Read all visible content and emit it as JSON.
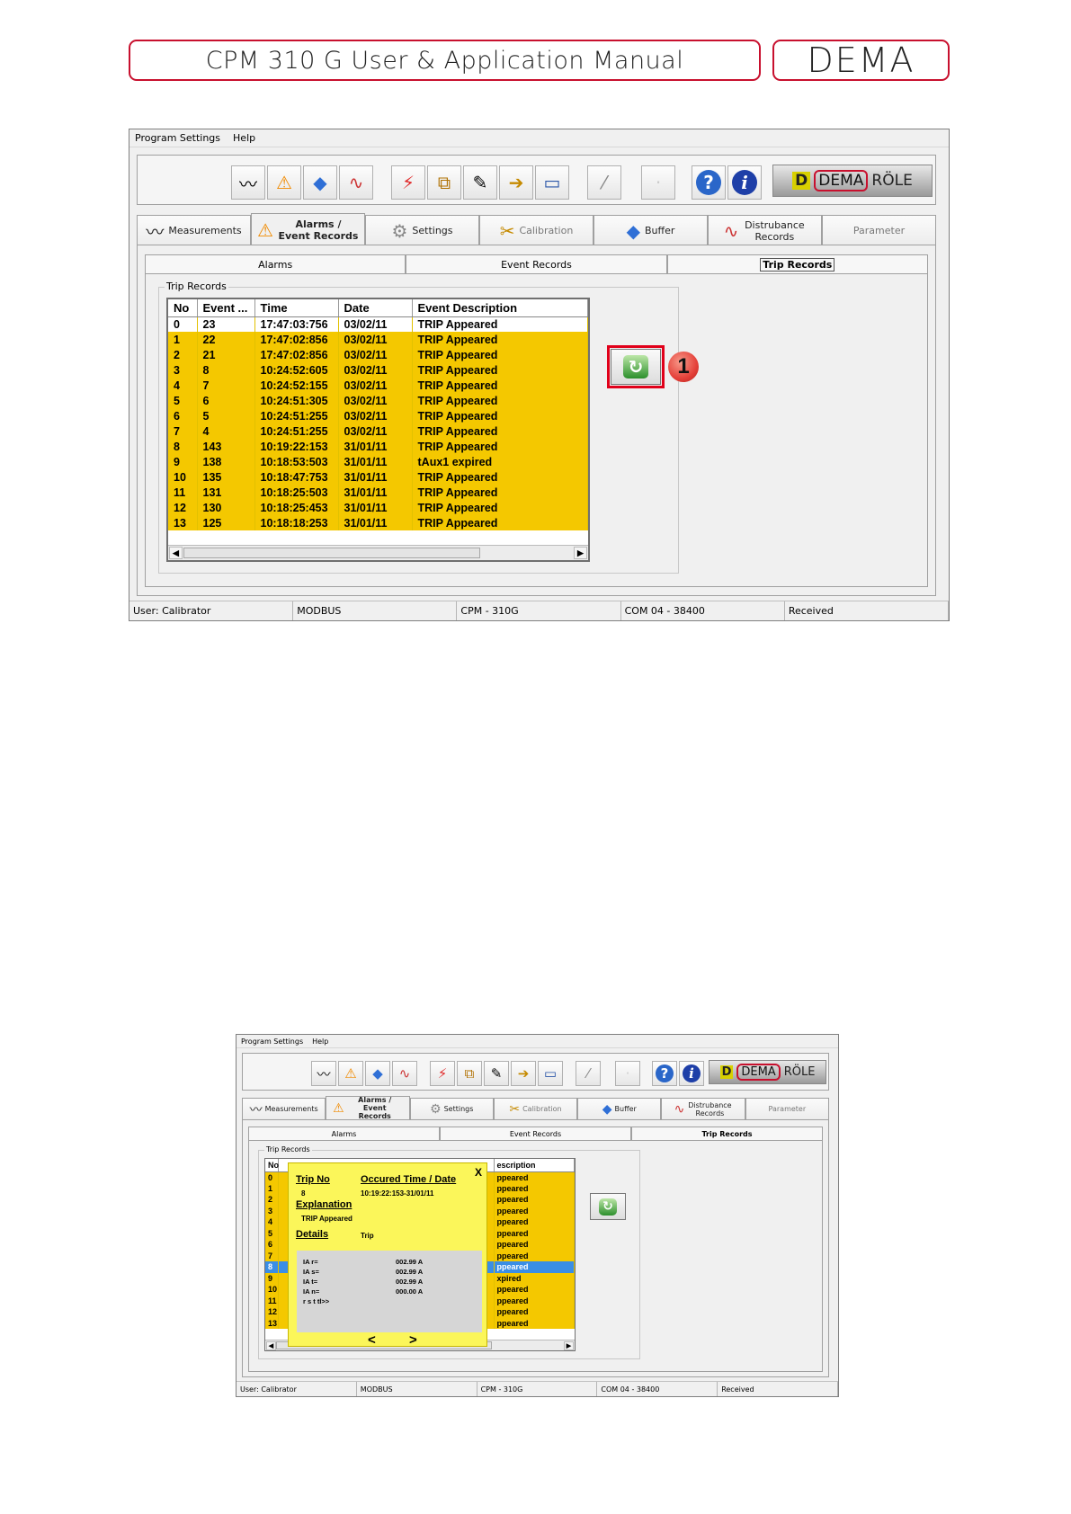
{
  "header": {
    "title": "CPM 310 G User & Application Manual",
    "logo": "DEMA"
  },
  "menu": [
    "Program Settings",
    "Help"
  ],
  "toolbar_icons": [
    "waveform-icon",
    "warning-icon",
    "gem-icon",
    "chart-icon",
    "breaker-icon",
    "transformer-icon",
    "tools-icon",
    "export-icon",
    "device-icon",
    "wand-icon",
    "blank-icon",
    "help-icon",
    "info-icon"
  ],
  "toolbar_logo": {
    "mark": "D",
    "brand": "DEMA",
    "suffix": "RÖLE"
  },
  "tabs": [
    {
      "label": "Measurements",
      "icon": "waveform-icon"
    },
    {
      "label": "Alarms / Event Records",
      "icon": "warning-icon"
    },
    {
      "label": "Settings",
      "icon": "gears-icon"
    },
    {
      "label": "Calibration",
      "icon": "tools-icon"
    },
    {
      "label": "Buffer",
      "icon": "gem-icon"
    },
    {
      "label": "Distrubance Records",
      "icon": "chart-icon"
    },
    {
      "label": "Parameter",
      "icon": ""
    }
  ],
  "subtabs": [
    "Alarms",
    "Event Records",
    "Trip Records"
  ],
  "group_title": "Trip Records",
  "columns": [
    "No",
    "Event ...",
    "Time",
    "Date",
    "Event Description"
  ],
  "rows": [
    [
      "0",
      "23",
      "17:47:03:756",
      "03/02/11",
      "TRIP Appeared"
    ],
    [
      "1",
      "22",
      "17:47:02:856",
      "03/02/11",
      "TRIP Appeared"
    ],
    [
      "2",
      "21",
      "17:47:02:856",
      "03/02/11",
      "TRIP Appeared"
    ],
    [
      "3",
      "8",
      "10:24:52:605",
      "03/02/11",
      "TRIP Appeared"
    ],
    [
      "4",
      "7",
      "10:24:52:155",
      "03/02/11",
      "TRIP Appeared"
    ],
    [
      "5",
      "6",
      "10:24:51:305",
      "03/02/11",
      "TRIP Appeared"
    ],
    [
      "6",
      "5",
      "10:24:51:255",
      "03/02/11",
      "TRIP Appeared"
    ],
    [
      "7",
      "4",
      "10:24:51:255",
      "03/02/11",
      "TRIP Appeared"
    ],
    [
      "8",
      "143",
      "10:19:22:153",
      "31/01/11",
      "TRIP Appeared"
    ],
    [
      "9",
      "138",
      "10:18:53:503",
      "31/01/11",
      "tAux1 expired"
    ],
    [
      "10",
      "135",
      "10:18:47:753",
      "31/01/11",
      "TRIP Appeared"
    ],
    [
      "11",
      "131",
      "10:18:25:503",
      "31/01/11",
      "TRIP Appeared"
    ],
    [
      "12",
      "130",
      "10:18:25:453",
      "31/01/11",
      "TRIP Appeared"
    ],
    [
      "13",
      "125",
      "10:18:18:253",
      "31/01/11",
      "TRIP Appeared"
    ]
  ],
  "callout": "1",
  "status": [
    "User: Calibrator",
    "MODBUS",
    "CPM - 310G",
    "COM 04 - 38400",
    "Received"
  ],
  "popup": {
    "close": "X",
    "trip_no_label": "Trip No",
    "trip_no": "8",
    "time_label": "Occured Time / Date",
    "time_value": "10:19:22:153-31/01/11",
    "explanation_label": "Explanation",
    "explanation": "TRIP Appeared",
    "details_label": "Details",
    "details_type": "Trip",
    "details": [
      {
        "name": "IA r=",
        "value": "002.99 A"
      },
      {
        "name": "IA s=",
        "value": "002.99 A"
      },
      {
        "name": "IA t=",
        "value": "002.99 A"
      },
      {
        "name": "IA n=",
        "value": "000.00 A"
      },
      {
        "name": "r s t tl>>",
        "value": ""
      }
    ],
    "prev": "<",
    "next": ">"
  },
  "win2_grid": {
    "columns": [
      "No",
      "escription"
    ],
    "rows": [
      [
        "0",
        "ppeared"
      ],
      [
        "1",
        "ppeared"
      ],
      [
        "2",
        "ppeared"
      ],
      [
        "3",
        "ppeared"
      ],
      [
        "4",
        "ppeared"
      ],
      [
        "5",
        "ppeared"
      ],
      [
        "6",
        "ppeared"
      ],
      [
        "7",
        "ppeared"
      ],
      [
        "8",
        "ppeared"
      ],
      [
        "9",
        "xpired"
      ],
      [
        "10",
        "ppeared"
      ],
      [
        "11",
        "ppeared"
      ],
      [
        "12",
        "ppeared"
      ],
      [
        "13",
        "ppeared"
      ]
    ],
    "selected_row": "8"
  },
  "colors": {
    "accent_red": "#c8102e",
    "row_highlight": "#f4c800",
    "row_selected": "#3a8ee6",
    "popup_bg": "#fbf65a"
  }
}
